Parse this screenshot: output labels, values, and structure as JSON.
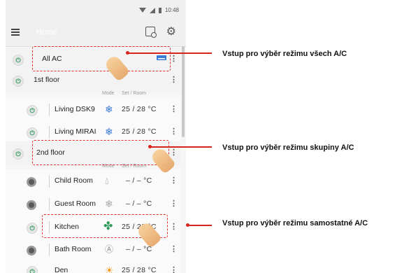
{
  "status": {
    "time": "10:48"
  },
  "app": {
    "title": "Home"
  },
  "subheader": {
    "mode": "Mode",
    "setroom": "Set / Room"
  },
  "rows": {
    "all_ac": "All AC",
    "floor1": "1st floor",
    "living_dsk9": {
      "name": "Living DSK9",
      "temp": "25 / 28 °C"
    },
    "living_mirai": {
      "name": "Living MIRAI",
      "temp": "25 / 28 °C"
    },
    "floor2": "2nd floor",
    "child": {
      "name": "Child Room",
      "temp": "– / –  °C"
    },
    "guest": {
      "name": "Guest Room",
      "temp": "– / –  °C"
    },
    "kitchen": {
      "name": "Kitchen",
      "temp": "25 / 28 °C"
    },
    "bath": {
      "name": "Bath Room",
      "temp": "– / –  °C"
    },
    "den": {
      "name": "Den",
      "temp": "25 / 28 °C"
    }
  },
  "callouts": {
    "all": "Vstup pro výběr režimu všech A/C",
    "group": "Vstup pro výběr režimu skupiny A/C",
    "single": "Vstup pro výběr režimu samostatné A/C"
  },
  "icons": {
    "menu": "hamburger-menu-icon",
    "schedule": "calendar-clock-icon",
    "settings": "gear-icon",
    "cool": "snowflake-icon",
    "fan": "fan-icon",
    "dry": "droplet-icon",
    "auto": "auto-mode-icon",
    "heat": "sun-icon"
  },
  "colors": {
    "highlight": "#e0302c",
    "power_on": "#2e9a5a",
    "cool": "#3a7bd5",
    "fan": "#2e9a5a",
    "heat": "#f39a1e"
  }
}
